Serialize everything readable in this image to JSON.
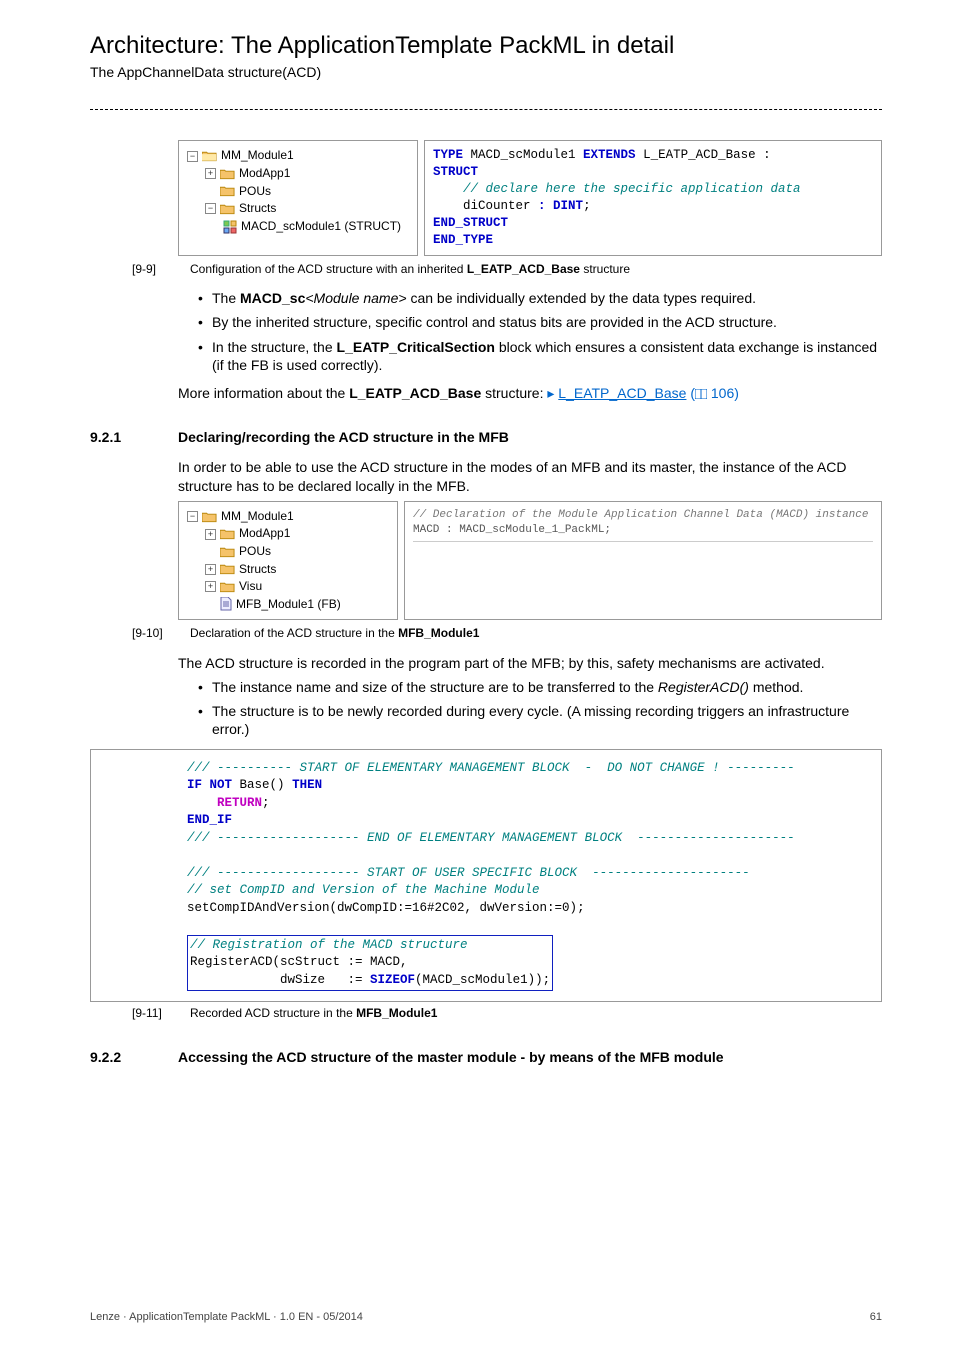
{
  "header": {
    "title": "Architecture: The ApplicationTemplate PackML in detail",
    "subtitle": "The AppChannelData structure(ACD)"
  },
  "fig1": {
    "tree": {
      "root": "MM_Module1",
      "child1": "ModApp1",
      "child2": "POUs",
      "child3": "Structs",
      "leaf": "MACD_scModule1 (STRUCT)"
    },
    "code": {
      "l1a": "TYPE",
      "l1b": " MACD_scModule1 ",
      "l1c": "EXTENDS",
      "l1d": " L_EATP_ACD_Base :",
      "l2": "STRUCT",
      "l3": "    // declare here the specific application data",
      "l4a": "    diCounter ",
      "l4b": ": ",
      "l4c": "DINT",
      "l4d": ";",
      "l5": "END_STRUCT",
      "l6": "END_TYPE"
    },
    "caption_num": "[9-9]",
    "caption_text_a": "Configuration of the ACD structure with an inherited ",
    "caption_text_b": "L_EATP_ACD_Base",
    "caption_text_c": " structure"
  },
  "bullets1": {
    "b1a": "The ",
    "b1b": "MACD_sc",
    "b1c": "<Module name>",
    "b1d": " can be individually extended by the data types required.",
    "b2": "By the inherited structure, specific control and status bits are provided in the ACD structure.",
    "b3a": "In the structure, the ",
    "b3b": "L_EATP_CriticalSection",
    "b3c": " block which ensures a consistent data exchange is instanced (if the FB is used correctly)."
  },
  "para1": {
    "a": "More information about the ",
    "b": "L_EATP_ACD_Base",
    "c": " structure: ",
    "link": "L_EATP_ACD_Base",
    "page": " 106)"
  },
  "sec921": {
    "num": "9.2.1",
    "title": "Declaring/recording the ACD structure in the MFB"
  },
  "para2": "In order to be able to use the ACD structure in the modes of an MFB and its master, the instance of the ACD structure has to be declared locally in the MFB.",
  "fig2": {
    "tree": {
      "root": "MM_Module1",
      "c1": "ModApp1",
      "c2": "POUs",
      "c3": "Structs",
      "c4": "Visu",
      "leaf": "MFB_Module1 (FB)"
    },
    "code": {
      "l1": "// Declaration of the Module Application Channel Data (MACD) instance",
      "l2": "MACD : MACD_scModule_1_PackML;"
    },
    "caption_num": "[9-10]",
    "caption_text_a": "Declaration of the ACD structure in the ",
    "caption_text_b": "MFB_Module1"
  },
  "para3": "The ACD structure is recorded in the program part of the MFB; by this, safety mechanisms are activated.",
  "bullets2": {
    "b1a": "The instance name and size of the structure are to be transferred to the ",
    "b1b": "RegisterACD()",
    "b1c": " method.",
    "b2": "The structure is to be newly recorded during every cycle. (A missing recording triggers an infrastructure error.)"
  },
  "fig3": {
    "l1": "/// ---------- START OF ELEMENTARY MANAGEMENT BLOCK  -  DO NOT CHANGE ! ---------",
    "l2a": "IF",
    "l2b": " ",
    "l2c": "NOT",
    "l2d": " Base() ",
    "l2e": "THEN",
    "l3": "    RETURN",
    "l4": "END_IF",
    "l5": "/// ------------------- END OF ELEMENTARY MANAGEMENT BLOCK  ---------------------",
    "l6": "",
    "l7": "/// ------------------- START OF USER SPECIFIC BLOCK  ---------------------",
    "l8": "// set CompID and Version of the Machine Module",
    "l9": "setCompIDAndVersion(dwCompID:=16#2C02, dwVersion:=0);",
    "l10": "",
    "l11": "// Registration of the MACD structure",
    "l12": "RegisterACD(scStruct := MACD,",
    "l13a": "            dwSize   := ",
    "l13b": "SIZEOF",
    "l13c": "(MACD_scModule1));",
    "caption_num": "[9-11]",
    "caption_text_a": "Recorded ACD structure in the ",
    "caption_text_b": "MFB_Module1"
  },
  "sec922": {
    "num": "9.2.2",
    "title": "Accessing the ACD structure of the master module - by means of the MFB module"
  },
  "footer": {
    "left": "Lenze · ApplicationTemplate PackML · 1.0 EN - 05/2014",
    "right": "61"
  }
}
